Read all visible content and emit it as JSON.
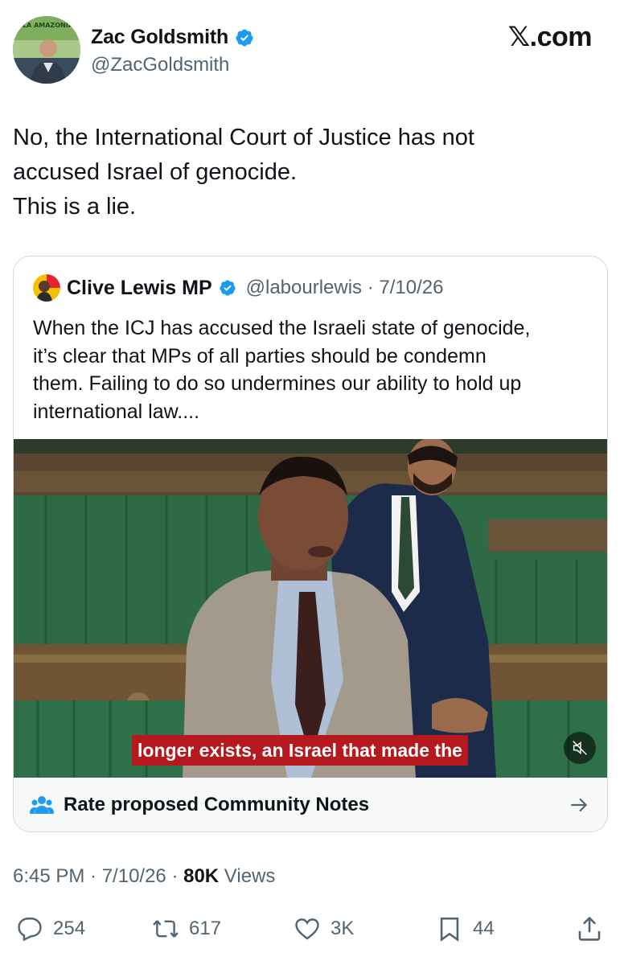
{
  "tweet": {
    "author": {
      "display_name": "Zac Goldsmith",
      "handle": "@ZacGoldsmith",
      "avatar_banner_text": "LA AMAZONÍA",
      "verified": true
    },
    "brand": "𝕏.com",
    "text_lines": [
      "No, the International Court of Justice has not",
      "accused Israel of genocide.",
      "This is a lie."
    ],
    "quote": {
      "display_name": "Clive Lewis MP",
      "handle_date": "@labourlewis · 7/10/26",
      "verified": true,
      "text_lines": [
        "When the ICJ has accused the Israeli state of genocide,",
        "it’s clear that MPs of all parties should be condemn",
        "them. Failing to do so undermines our ability to hold up",
        "international law...."
      ],
      "video_caption": "longer exists, an Israel that made the",
      "community_notes_label": "Rate proposed Community Notes"
    },
    "meta": {
      "time_date": "6:45 PM · 7/10/26 · ",
      "views_count": "80K",
      "views_label": " Views"
    },
    "actions": {
      "replies": "254",
      "reposts": "617",
      "likes": "3K",
      "bookmarks": "44"
    }
  },
  "colors": {
    "text": "#0f1419",
    "secondary": "#536471",
    "verified_blue": "#1d9bf0",
    "border": "#cfd9de",
    "caption_red": "#b5181d",
    "bench_green": "#2f6b46"
  }
}
